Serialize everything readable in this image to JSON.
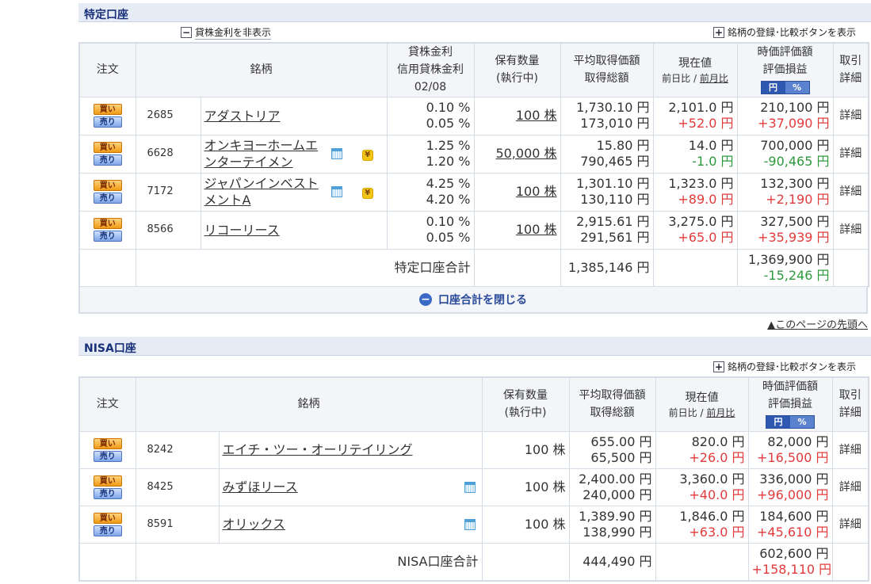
{
  "tokutei": {
    "title": "特定口座",
    "toggle_lending": "貸株金利を非表示",
    "toggle_compare": "銘柄の登録･比較ボタンを表示",
    "headers": {
      "order": "注文",
      "name": "銘柄",
      "rate1": "貸株金利",
      "rate2": "信用貸株金利",
      "rate_date": "02/08",
      "qty1": "保有数量",
      "qty2": "(執行中)",
      "avg1": "平均取得価額",
      "avg2": "取得総額",
      "cur1": "現在値",
      "cur_sub1": "前日比",
      "cur_sep": " / ",
      "cur_sub2": "前月比",
      "val1": "時価評価額",
      "val2": "評価損益",
      "seg_yen": "円",
      "seg_pct": "%",
      "trade1": "取引",
      "trade2": "詳細"
    },
    "rows": [
      {
        "code": "2685",
        "name": "アダストリア",
        "name2": "",
        "rate1": "0.10 %",
        "rate2": "0.05 %",
        "qty": "100 株",
        "avg": "1,730.10 円",
        "cost": "173,010 円",
        "price": "2,101.0 円",
        "change": "+52.0 円",
        "value": "210,100 円",
        "pl": "+37,090 円",
        "cal": false,
        "coin": false
      },
      {
        "code": "6628",
        "name": "オンキヨーホームエ",
        "name2": "ンターテイメン",
        "rate1": "1.25 %",
        "rate2": "1.20 %",
        "qty": "50,000 株",
        "avg": "15.80 円",
        "cost": "790,465 円",
        "price": "14.0 円",
        "change": "-1.0 円",
        "value": "700,000 円",
        "pl": "-90,465 円",
        "cal": true,
        "coin": true
      },
      {
        "code": "7172",
        "name": "ジャパンインベスト",
        "name2": "メントA",
        "rate1": "4.25 %",
        "rate2": "4.20 %",
        "qty": "100 株",
        "avg": "1,301.10 円",
        "cost": "130,110 円",
        "price": "1,323.0 円",
        "change": "+89.0 円",
        "value": "132,300 円",
        "pl": "+2,190 円",
        "cal": true,
        "coin": true
      },
      {
        "code": "8566",
        "name": "リコーリース",
        "name2": "",
        "rate1": "0.10 %",
        "rate2": "0.05 %",
        "qty": "100 株",
        "avg": "2,915.61 円",
        "cost": "291,561 円",
        "price": "3,275.0 円",
        "change": "+65.0 円",
        "value": "327,500 円",
        "pl": "+35,939 円",
        "cal": false,
        "coin": false
      }
    ],
    "total_label": "特定口座合計",
    "total_cost": "1,385,146 円",
    "total_value": "1,369,900 円",
    "total_pl": "-15,246 円",
    "close_label": "口座合計を閉じる",
    "close_icon": "minus-circle-icon"
  },
  "top_link": "▲このページの先頭へ",
  "nisa": {
    "title": "NISA口座",
    "toggle_compare": "銘柄の登録･比較ボタンを表示",
    "rows": [
      {
        "code": "8242",
        "name": "エイチ・ツー・オーリテイリング",
        "qty": "100 株",
        "avg": "655.00 円",
        "cost": "65,500 円",
        "price": "820.0 円",
        "change": "+26.0 円",
        "value": "82,000 円",
        "pl": "+16,500 円",
        "cal": false
      },
      {
        "code": "8425",
        "name": "みずほリース",
        "qty": "100 株",
        "avg": "2,400.00 円",
        "cost": "240,000 円",
        "price": "3,360.0 円",
        "change": "+40.0 円",
        "value": "336,000 円",
        "pl": "+96,000 円",
        "cal": true
      },
      {
        "code": "8591",
        "name": "オリックス",
        "qty": "100 株",
        "avg": "1,389.90 円",
        "cost": "138,990 円",
        "price": "1,846.0 円",
        "change": "+63.0 円",
        "value": "184,600 円",
        "pl": "+45,610 円",
        "cal": true
      }
    ],
    "total_label": "NISA口座合計",
    "total_cost": "444,490 円",
    "total_value": "602,600 円",
    "total_pl": "+158,110 円"
  },
  "buttons": {
    "buy": "買い",
    "sell": "売り",
    "detail": "詳細"
  },
  "colors": {
    "positive": "#e23b3b",
    "negative": "#2c9a3c",
    "section_bg": "#e6ecf6",
    "title": "#19317a"
  }
}
